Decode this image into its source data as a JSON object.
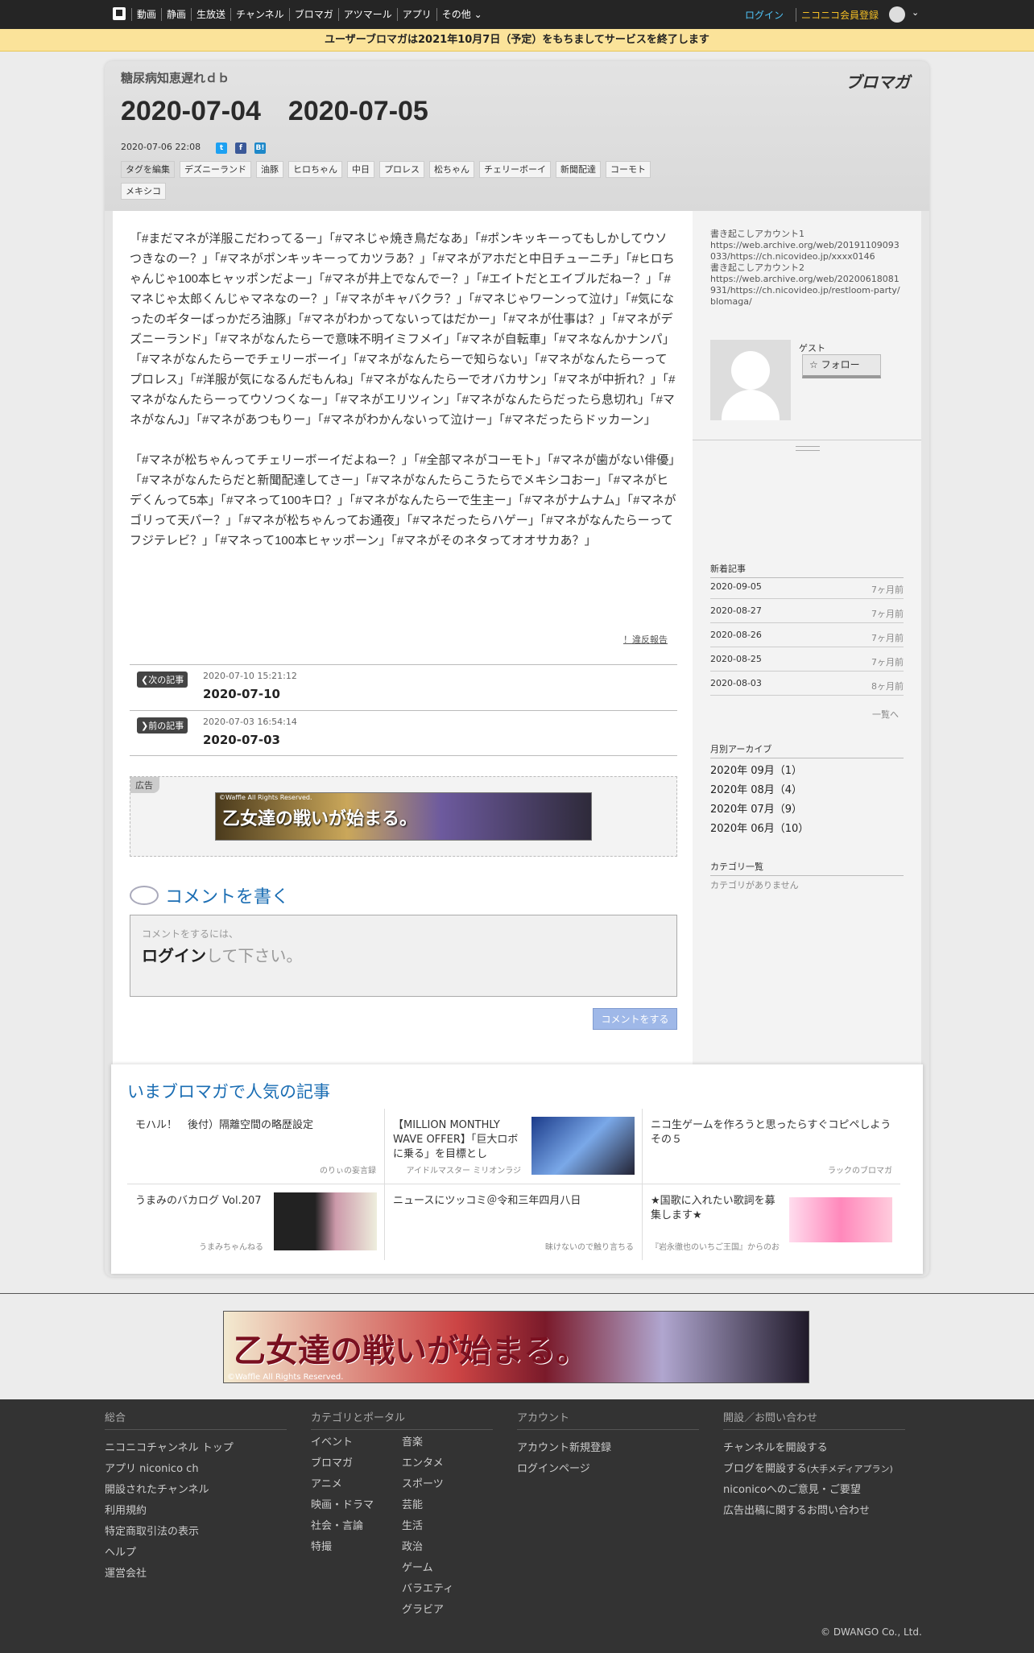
{
  "topnav": {
    "links": [
      "動画",
      "静画",
      "生放送",
      "チャンネル",
      "ブロマガ",
      "アツマール",
      "アプリ",
      "その他"
    ],
    "login": "ログイン",
    "register": "ニコニコ会員登録"
  },
  "notice": "ユーザーブロマガは2021年10月7日（予定）をもちましてサービスを終了します",
  "header": {
    "channel": "糖尿病知恵遅れｄｂ",
    "logo": "ブロマガ",
    "title": "2020-07-04　2020-07-05",
    "date": "2020-07-06 22:08",
    "tag_edit": "タグを編集",
    "tags": [
      "デズニーランド",
      "油豚",
      "ヒロちゃん",
      "中日",
      "プロレス",
      "松ちゃん",
      "チェリーボーイ",
      "新聞配達",
      "コーモト",
      "メキシコ"
    ]
  },
  "article": {
    "p1": "「#まだマネが洋服こだわってるー」「#マネじゃ焼き鳥だなあ」「#ポンキッキーってもしかしてウソつきなのー？」「#マネがポンキッキーってカツラあ？」「#マネがアホだと中日チューニチ」「#ヒロちゃんじゃ100本ヒャッポンだよー」「#マネが井上でなんでー？」「#エイトだとエイブルだねー？」「#マネじゃ太郎くんじゃマネなのー？」「#マネがキャバクラ？」「#マネじゃワーンって泣け」「#気になったのギターばっかだろ油豚」「#マネがわかってないってはだかー」「#マネが仕事は？」「#マネがデズニーランド」「#マネがなんたらーで意味不明イミフメイ」「#マネが自転車」「#マネなんかナンパ」「#マネがなんたらーでチェリーボーイ」「#マネがなんたらーで知らない」「#マネがなんたらーってプロレス」「#洋服が気になるんだもんね」「#マネがなんたらーでオバカサン」「#マネが中折れ？」「#マネがなんたらーってウソつくなー」「#マネがエリツィン」「#マネがなんたらだったら息切れ」「#マネがなんJ」「#マネがあつもりー」「#マネがわかんないって泣けー」「#マネだったらドッカーン」",
    "p2": "「#マネが松ちゃんってチェリーボーイだよねー？」「#全部マネがコーモト」「#マネが歯がない俳優」「#マネがなんたらだと新聞配達してさー」「#マネがなんたらこうたらでメキシコおー」「#マネがヒデくんって5本」「#マネって100キロ？」「#マネがなんたらーで生主ー」「#マネがナムナム」「#マネがゴリって天パー？」「#マネが松ちゃんってお通夜」「#マネだったらハゲー」「#マネがなんたらーってフジテレビ？」「#マネって100本ヒャッポーン」「#マネがそのネタってオオサカあ？」",
    "report": "！違反報告"
  },
  "nav": {
    "next_label": "次の記事",
    "next_date": "2020-07-10 15:21:12",
    "next_title": "2020-07-10",
    "prev_label": "前の記事",
    "prev_date": "2020-07-03 16:54:14",
    "prev_title": "2020-07-03"
  },
  "ad": {
    "label": "広告",
    "banner_text": "乙女達の戦いが始まる。",
    "banner_note": "©Waffle All Rights Reserved."
  },
  "comment": {
    "title": "コメントを書く",
    "hint": "コメントをするには、",
    "login": "ログイン",
    "login_suffix": "して下さい。",
    "button": "コメントをする"
  },
  "sidebar": {
    "accounts": "書き起こしアカウント1\nhttps://web.archive.org/web/20191109093033/https://ch.nicovideo.jp/xxxx0146\n書き起こしアカウント2\nhttps://web.archive.org/web/20200618081931/https://ch.nicovideo.jp/restloom-party/blomaga/",
    "guest": "ゲスト",
    "follow": "フォロー",
    "new_heading": "新着記事",
    "new_items": [
      {
        "date": "2020-09-05",
        "ago": "7ヶ月前"
      },
      {
        "date": "2020-08-27",
        "ago": "7ヶ月前"
      },
      {
        "date": "2020-08-26",
        "ago": "7ヶ月前"
      },
      {
        "date": "2020-08-25",
        "ago": "7ヶ月前"
      },
      {
        "date": "2020-08-03",
        "ago": "8ヶ月前"
      }
    ],
    "more": "一覧へ",
    "archive_heading": "月別アーカイブ",
    "archive": [
      "2020年 09月（1）",
      "2020年 08月（4）",
      "2020年 07月（9）",
      "2020年 06月（10）"
    ],
    "category_heading": "カテゴリ一覧",
    "category_none": "カテゴリがありません"
  },
  "popular": {
    "title": "いまブロマガで人気の記事",
    "items": [
      {
        "title": "モハル！　後付）隔離空間の略歴設定",
        "author": "のりぃの妄言録"
      },
      {
        "title": "【MILLION MONTHLY WAVE OFFER】「巨大ロボに乗る」を目標とし",
        "author": "アイドルマスター ミリオンラジ"
      },
      {
        "title": "ニコ生ゲームを作ろうと思ったらすぐコピペしよう　その５",
        "author": "ラックのブロマガ"
      },
      {
        "title": "うまみのバカログ Vol.207",
        "author": "うまみちゃんねる"
      },
      {
        "title": "ニュースにツッコミ＠令和三年四月八日",
        "author": "昧けないので触り言ちる"
      },
      {
        "title": "★国歌に入れたい歌詞を募集します★",
        "author": "『岩永徹也のいちご王国』からのお"
      }
    ]
  },
  "bottom_ad": {
    "text": "乙女達の戦いが始まる。",
    "note": "©Waffle All Rights Reserved."
  },
  "footer": {
    "col1_h": "総合",
    "col1": [
      "ニコニコチャンネル トップ",
      "アプリ niconico ch",
      "開設されたチャンネル",
      "利用規約",
      "特定商取引法の表示",
      "ヘルプ",
      "運営会社"
    ],
    "col2_h": "カテゴリとポータル",
    "col2a": [
      "イベント",
      "ブロマガ",
      "アニメ",
      "映画・ドラマ",
      "社会・言論",
      "特撮"
    ],
    "col2b": [
      "音楽",
      "エンタメ",
      "スポーツ",
      "芸能",
      "生活",
      "政治",
      "ゲーム",
      "バラエティ",
      "グラビア"
    ],
    "col3_h": "アカウント",
    "col3": [
      "アカウント新規登録",
      "ログインページ"
    ],
    "col4_h": "開設／お問い合わせ",
    "col4": [
      "チャンネルを開設する",
      "ブログを開設する",
      "niconicoへのご意見・ご要望",
      "広告出稿に関するお問い合わせ"
    ],
    "col4_small": "(大手メディアプラン)",
    "copyright": "© DWANGO Co., Ltd."
  }
}
